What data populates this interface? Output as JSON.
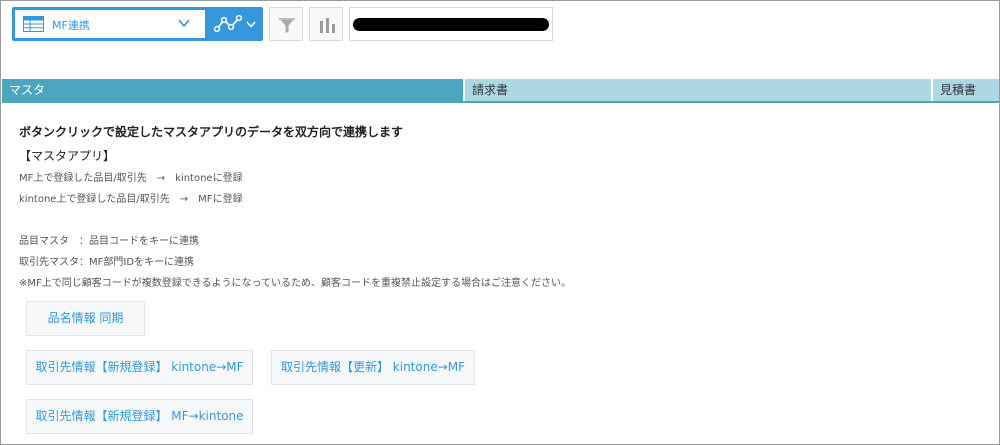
{
  "toolbar": {
    "view_name": "MF連携",
    "icons": {
      "view": "table-icon",
      "graph": "graph-icon",
      "filter": "filter-icon",
      "chart": "bar-chart-icon",
      "dropdown": "chevron-down-icon"
    },
    "accent_color": "#3498db"
  },
  "tabs": [
    {
      "label": "マスタ",
      "active": true
    },
    {
      "label": "請求書",
      "active": false
    },
    {
      "label": "見積書",
      "active": false
    }
  ],
  "tab_colors": {
    "active": "#4ba7bf",
    "inactive": "#add8e3"
  },
  "content": {
    "heading": "ボタンクリックで設定したマスタアプリのデータを双方向で連携します",
    "subheading": "【マスタアプリ】",
    "lines": [
      "MF上で登録した品目/取引先　→　kintoneに登録",
      "kintone上で登録した品目/取引先　→　MFに登録",
      "品目マスタ　：品目コードをキーに連携",
      "取引先マスタ：MF部門IDをキーに連携",
      "※MF上で同じ顧客コードが複数登録できるようになっているため、顧客コードを重複禁止設定する場合はご注意ください。"
    ]
  },
  "buttons": {
    "item_sync": "品名情報 同期",
    "client_new_to_mf": "取引先情報【新規登録】 kintone→MF",
    "client_update_to_mf": "取引先情報【更新】 kintone→MF",
    "client_new_to_kintone": "取引先情報【新規登録】 MF→kintone"
  }
}
